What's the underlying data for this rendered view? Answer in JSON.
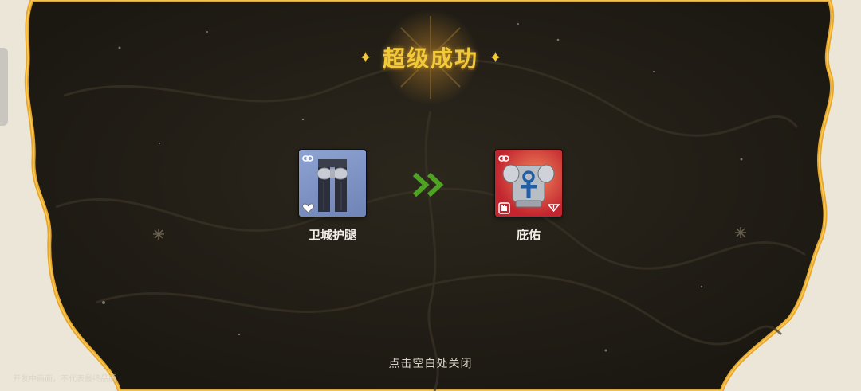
{
  "result": {
    "title": "超级成功",
    "sparkle_left": "✦",
    "sparkle_right": "✦"
  },
  "source_item": {
    "name": "卫城护腿",
    "card_color": "#7e93c2"
  },
  "target_item": {
    "name": "庇佑",
    "card_color": "#d8453a"
  },
  "arrow_icon": "double-chevron-right",
  "hint": "点击空白处关闭",
  "watermark": "开发中画面，不代表最终品质",
  "colors": {
    "title": "#f2c93a",
    "arrow": "#4ea322",
    "panel": "#231f17",
    "gold_border": "#e9a629"
  }
}
